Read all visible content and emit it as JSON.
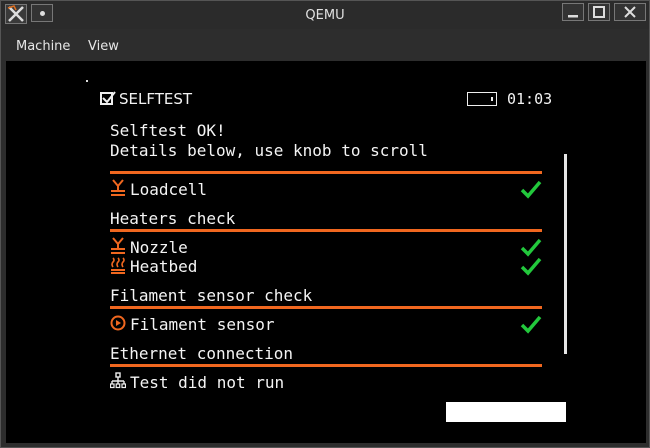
{
  "window": {
    "title": "QEMU",
    "icons": {
      "app": "qemu-logo-icon",
      "pin": "pin-dot-icon",
      "minimize": "minimize-icon",
      "maximize": "maximize-icon",
      "close": "close-icon"
    }
  },
  "menubar": {
    "items": [
      "Machine",
      "View"
    ]
  },
  "screen": {
    "header": {
      "title": "SELFTEST",
      "time": "01:03",
      "icons": {
        "title": "checkbox-checked-icon",
        "status": "battery-icon"
      }
    },
    "intro": [
      "Selftest OK!",
      "Details below, use knob to scroll"
    ],
    "sections": [
      {
        "title": "",
        "items": [
          {
            "label": "Loadcell",
            "icon": "loadcell-icon",
            "status": "ok"
          }
        ]
      },
      {
        "title": "Heaters check",
        "items": [
          {
            "label": "Nozzle",
            "icon": "nozzle-icon",
            "status": "ok"
          },
          {
            "label": "Heatbed",
            "icon": "heatbed-icon",
            "status": "ok"
          }
        ]
      },
      {
        "title": "Filament sensor check",
        "items": [
          {
            "label": "Filament sensor",
            "icon": "filament-sensor-icon",
            "status": "ok"
          }
        ]
      },
      {
        "title": "Ethernet connection",
        "items": [
          {
            "label": "Test did not run",
            "icon": "network-icon",
            "status": ""
          }
        ]
      }
    ],
    "colors": {
      "accent": "#f0671f",
      "ok": "#22c83c",
      "background": "#000000",
      "text": "#f4f4f4"
    }
  }
}
